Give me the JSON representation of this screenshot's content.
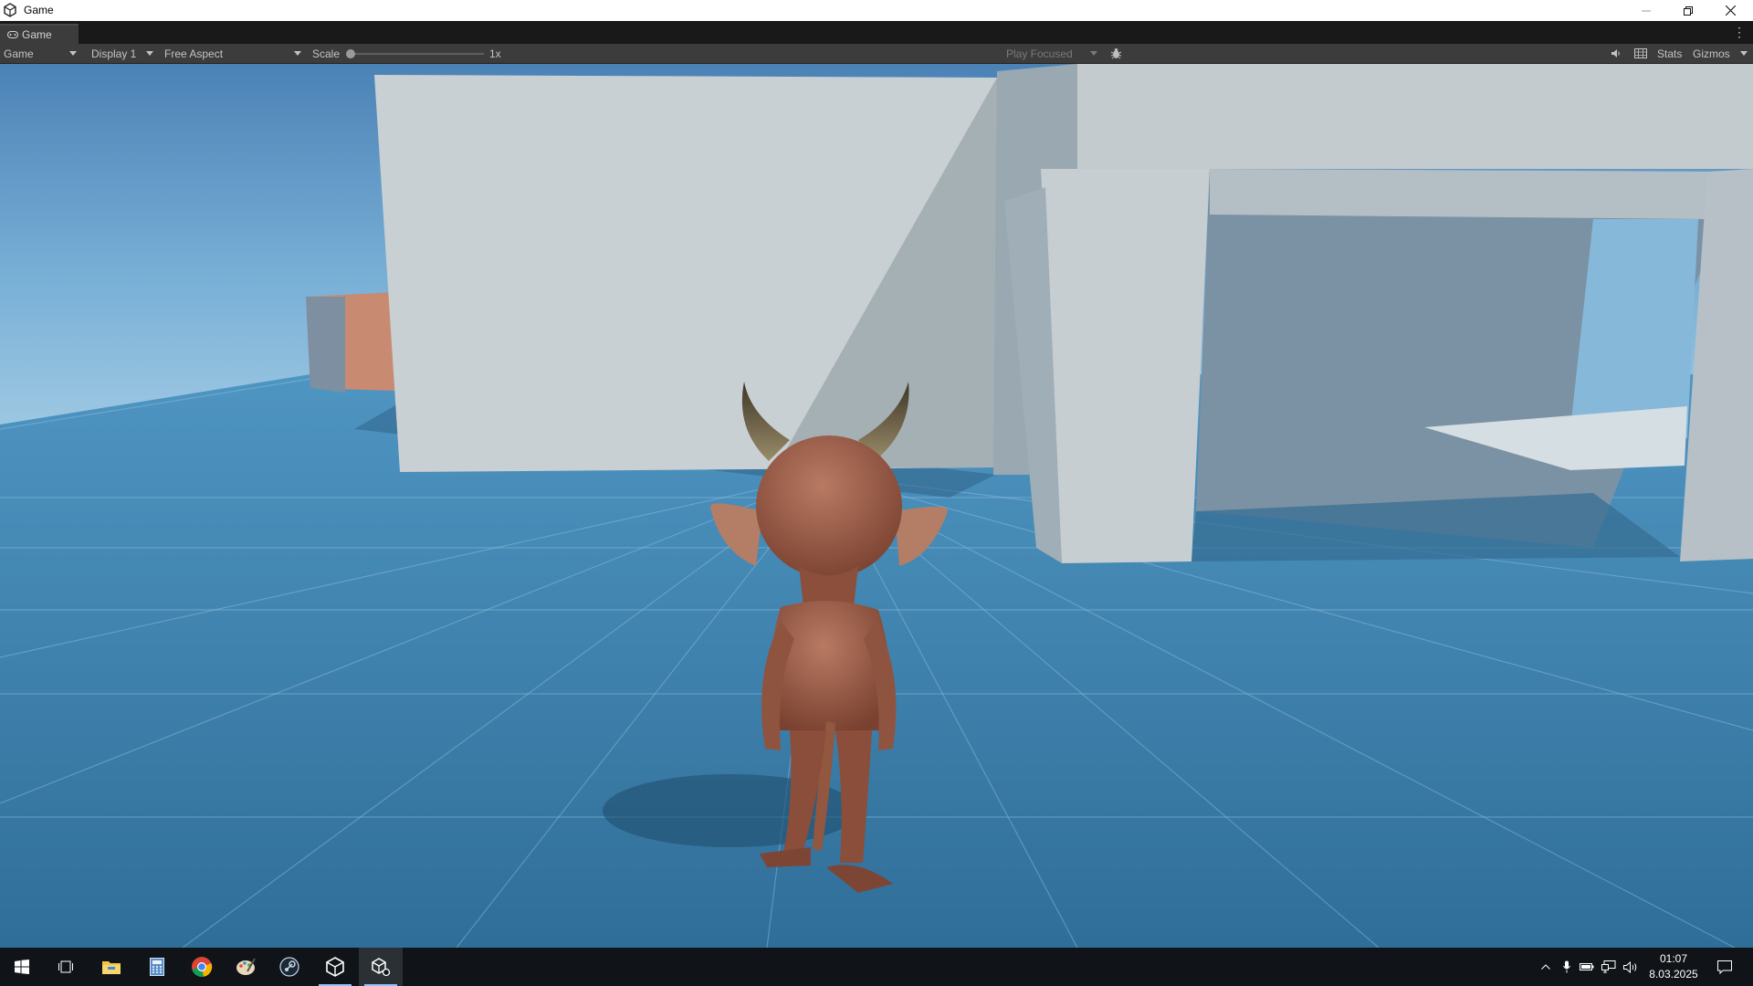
{
  "window": {
    "title": "Game",
    "icons": {
      "app": "unity-icon",
      "minimize": "minimize-icon",
      "restore": "restore-icon",
      "close": "close-icon"
    }
  },
  "tabs": [
    {
      "label": "Game",
      "icon": "gamepad-icon"
    }
  ],
  "toolbar": {
    "view_mode": "Game",
    "display": "Display 1",
    "aspect": "Free Aspect",
    "scale_label": "Scale",
    "scale_value": "1x",
    "scale_level": 0,
    "play_mode": "Play Focused",
    "stats": "Stats",
    "gizmos": "Gizmos",
    "icons": {
      "bug": "bug-icon",
      "audio": "speaker-icon",
      "grid": "grid-icon",
      "more": "kebab-menu-icon"
    }
  },
  "viewport": {
    "scene": "third-person character with horns and long ears walking on a blue grid floor toward grey wall blocks",
    "colors": {
      "sky_top": "#4d87bb",
      "sky_horizon": "#9cc6e2",
      "floor": "#3b7fae",
      "walls": "#c7cfd1",
      "character": "#9a5a45"
    }
  },
  "taskbar": {
    "apps": [
      {
        "name": "start-icon"
      },
      {
        "name": "task-view-icon"
      },
      {
        "name": "file-explorer-icon"
      },
      {
        "name": "calculator-icon"
      },
      {
        "name": "chrome-icon"
      },
      {
        "name": "paint-icon"
      },
      {
        "name": "steam-icon"
      },
      {
        "name": "unity-hub-icon"
      },
      {
        "name": "unity-editor-icon"
      }
    ],
    "time": "01:07",
    "date": "8.03.2025",
    "tray_icons": [
      "chevron-up-icon",
      "microphone-icon",
      "battery-icon",
      "network-icon",
      "speaker-icon",
      "notification-icon"
    ]
  }
}
